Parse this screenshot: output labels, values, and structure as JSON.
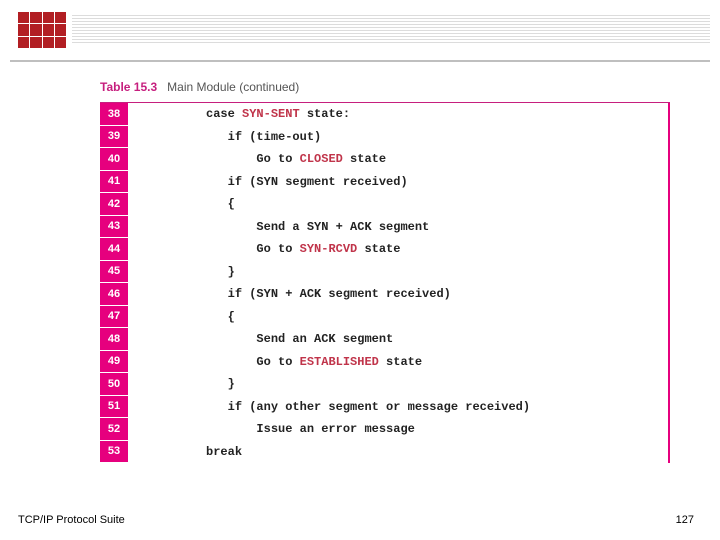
{
  "caption": {
    "label": "Table 15.3",
    "desc": "Main Module (continued)"
  },
  "lines": [
    {
      "n": "38",
      "indent": 10,
      "pre": "case ",
      "state": "SYN-SENT",
      "post": " state:"
    },
    {
      "n": "39",
      "indent": 13,
      "pre": "if (time-out)",
      "state": "",
      "post": ""
    },
    {
      "n": "40",
      "indent": 17,
      "pre": "Go to ",
      "state": "CLOSED",
      "post": " state"
    },
    {
      "n": "41",
      "indent": 13,
      "pre": "if (SYN segment received)",
      "state": "",
      "post": ""
    },
    {
      "n": "42",
      "indent": 13,
      "pre": "{",
      "state": "",
      "post": ""
    },
    {
      "n": "43",
      "indent": 17,
      "pre": "Send a SYN + ACK segment",
      "state": "",
      "post": ""
    },
    {
      "n": "44",
      "indent": 17,
      "pre": "Go to ",
      "state": "SYN-RCVD",
      "post": " state"
    },
    {
      "n": "45",
      "indent": 13,
      "pre": "}",
      "state": "",
      "post": ""
    },
    {
      "n": "46",
      "indent": 13,
      "pre": "if (SYN + ACK segment received)",
      "state": "",
      "post": ""
    },
    {
      "n": "47",
      "indent": 13,
      "pre": "{",
      "state": "",
      "post": ""
    },
    {
      "n": "48",
      "indent": 17,
      "pre": "Send an ACK segment",
      "state": "",
      "post": ""
    },
    {
      "n": "49",
      "indent": 17,
      "pre": "Go to ",
      "state": "ESTABLISHED",
      "post": " state"
    },
    {
      "n": "50",
      "indent": 13,
      "pre": "}",
      "state": "",
      "post": ""
    },
    {
      "n": "51",
      "indent": 13,
      "pre": "if (any other segment or message received)",
      "state": "",
      "post": ""
    },
    {
      "n": "52",
      "indent": 17,
      "pre": "Issue an error message",
      "state": "",
      "post": ""
    },
    {
      "n": "53",
      "indent": 10,
      "pre": "break",
      "state": "",
      "post": ""
    }
  ],
  "footer": {
    "left": "TCP/IP Protocol Suite",
    "right": "127"
  }
}
